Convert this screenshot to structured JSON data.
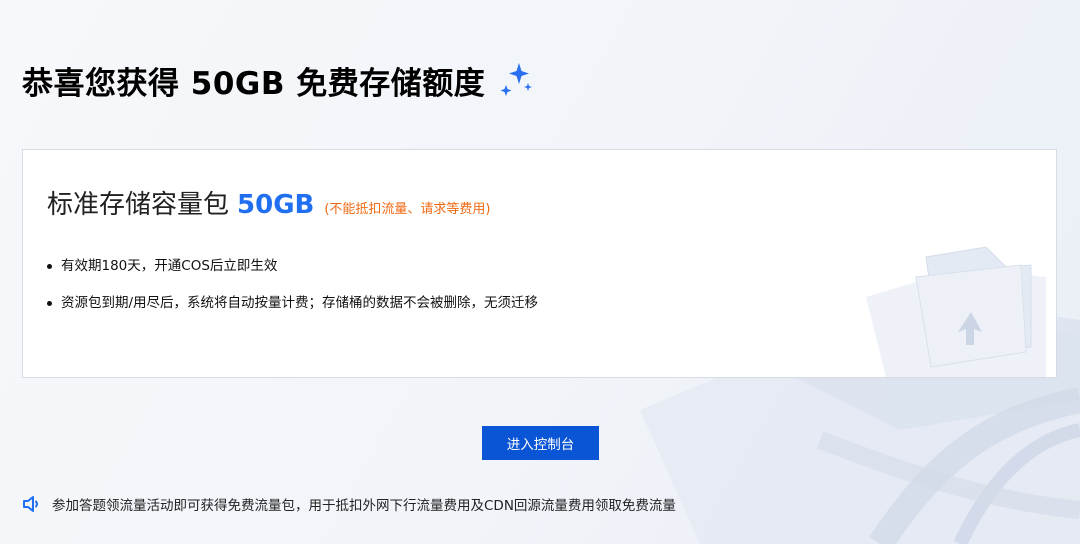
{
  "colors": {
    "accent": "#1f6ff0",
    "button": "#0a55d6",
    "warning_note": "#f06a14"
  },
  "header": {
    "title": "恭喜您获得 50GB 免费存储额度",
    "icon": "sparkle-icon"
  },
  "card": {
    "package_name": "标准存储容量包",
    "package_amount": "50GB",
    "package_note": "(不能抵扣流量、请求等费用)",
    "features": [
      "有效期180天，开通COS后立即生效",
      "资源包到期/用尽后，系统将自动按量计费；存储桶的数据不会被删除，无须迁移"
    ]
  },
  "actions": {
    "console_button_label": "进入控制台"
  },
  "notice": {
    "icon": "speaker-icon",
    "text": "参加答题领流量活动即可获得免费流量包，用于抵扣外网下行流量费用及CDN回源流量费用领取免费流量"
  }
}
